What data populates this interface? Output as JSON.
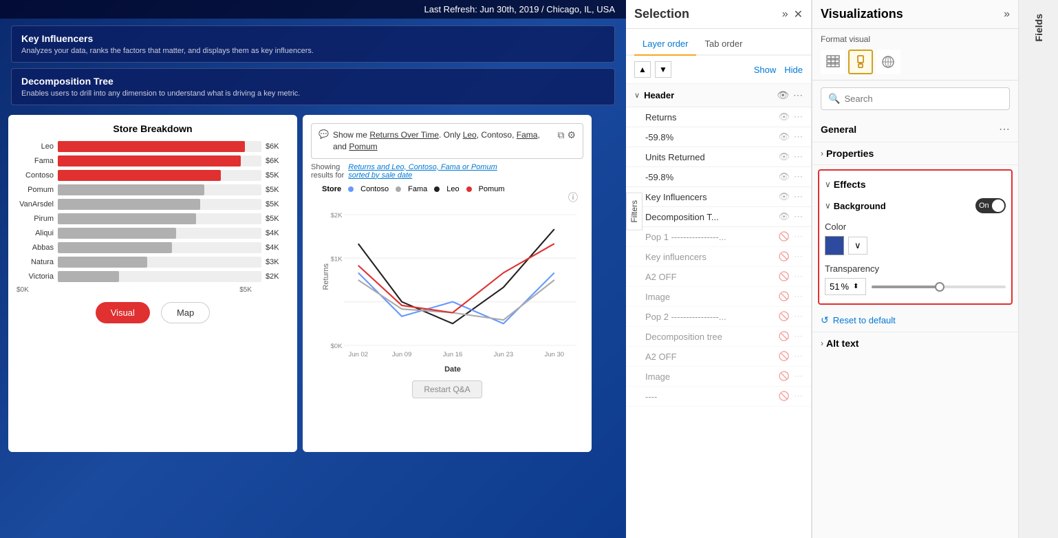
{
  "header": {
    "last_refresh": "Last Refresh: Jun 30th, 2019 / Chicago, IL, USA"
  },
  "viz_cards": [
    {
      "title": "Key Influencers",
      "description": "Analyzes your data, ranks the factors that matter, and displays them as key influencers."
    },
    {
      "title": "Decomposition Tree",
      "description": "Enables users to drill into any dimension to understand what is driving a key metric."
    }
  ],
  "store_breakdown": {
    "title": "Store Breakdown",
    "bars": [
      {
        "label": "Leo",
        "value": "$6K",
        "pct": 92,
        "type": "red"
      },
      {
        "label": "Fama",
        "value": "$6K",
        "pct": 90,
        "type": "red"
      },
      {
        "label": "Contoso",
        "value": "$5K",
        "pct": 80,
        "type": "red"
      },
      {
        "label": "Pomum",
        "value": "$5K",
        "pct": 72,
        "type": "gray"
      },
      {
        "label": "VanArsdel",
        "value": "$5K",
        "pct": 70,
        "type": "gray"
      },
      {
        "label": "Pirum",
        "value": "$5K",
        "pct": 68,
        "type": "gray"
      },
      {
        "label": "Aliqui",
        "value": "$4K",
        "pct": 58,
        "type": "gray"
      },
      {
        "label": "Abbas",
        "value": "$4K",
        "pct": 56,
        "type": "gray"
      },
      {
        "label": "Natura",
        "value": "$3K",
        "pct": 44,
        "type": "gray"
      },
      {
        "label": "Victoria",
        "value": "$2K",
        "pct": 30,
        "type": "gray"
      }
    ],
    "x_labels": [
      "$0K",
      "$5K"
    ],
    "buttons": {
      "visual": "Visual",
      "map": "Map"
    }
  },
  "qa_chart": {
    "query_text": "Show me Returns Over Time. Only Leo, Contoso, Fama, and Pomum",
    "results_label": "Showing results for",
    "results_link": "Returns and Leo, Contoso, Fama or Pomum sorted by sale date",
    "store_label": "Store",
    "legend": [
      {
        "label": "Contoso",
        "color": "#6699ff"
      },
      {
        "label": "Fama",
        "color": "#aaaaaa"
      },
      {
        "label": "Leo",
        "color": "#222222"
      },
      {
        "label": "Pomum",
        "color": "#e03030"
      }
    ],
    "x_labels": [
      "Jun 02",
      "Jun 09",
      "Jun 16",
      "Jun 23",
      "Jun 30"
    ],
    "y_labels": [
      "$2K",
      "$1K",
      "$0K"
    ],
    "x_axis_title": "Date",
    "y_axis_title": "Returns",
    "restart_btn": "Restart Q&A"
  },
  "filters_tab": "Filters",
  "selection_panel": {
    "title": "Selection",
    "tabs": [
      {
        "label": "Layer order",
        "active": true
      },
      {
        "label": "Tab order",
        "active": false
      }
    ],
    "controls": {
      "up": "▲",
      "down": "▼",
      "show": "Show",
      "hide": "Hide"
    },
    "group": {
      "label": "Header"
    },
    "items": [
      {
        "label": "Returns",
        "visible": true
      },
      {
        "label": "-59.8%",
        "visible": true
      },
      {
        "label": "Units Returned",
        "visible": true
      },
      {
        "label": "-59.8%",
        "visible": true
      },
      {
        "label": "Key Influencers",
        "visible": true
      },
      {
        "label": "Decomposition T...",
        "visible": true
      },
      {
        "label": "Pop 1 ----------------...",
        "visible": false
      },
      {
        "label": "Key influencers",
        "visible": false
      },
      {
        "label": "A2 OFF",
        "visible": false
      },
      {
        "label": "Image",
        "visible": false
      },
      {
        "label": "Pop 2 ----------------...",
        "visible": false
      },
      {
        "label": "Decomposition tree",
        "visible": false
      },
      {
        "label": "A2 OFF",
        "visible": false
      },
      {
        "label": "Image",
        "visible": false
      }
    ]
  },
  "viz_panel": {
    "title": "Visualizations",
    "header_expand_icon": "»",
    "format_label": "Format visual",
    "format_icons": [
      {
        "name": "table-icon",
        "symbol": "⊞",
        "active": false
      },
      {
        "name": "brush-icon",
        "symbol": "🖌",
        "active": true
      },
      {
        "name": "analytics-icon",
        "symbol": "⚬",
        "active": false
      }
    ],
    "search_placeholder": "Search",
    "sections": {
      "general": {
        "label": "General"
      },
      "properties": {
        "label": "Properties",
        "chevron": "›"
      },
      "effects": {
        "label": "Effects",
        "background": {
          "label": "Background",
          "toggle_state": "On",
          "color_label": "Color",
          "color_hex": "#2e4a9e",
          "transparency_label": "Transparency",
          "transparency_value": "51",
          "transparency_pct": "%"
        }
      },
      "alt_text": {
        "label": "Alt text"
      }
    },
    "reset_label": "Reset to default"
  },
  "fields_panel": {
    "label": "Fields"
  }
}
